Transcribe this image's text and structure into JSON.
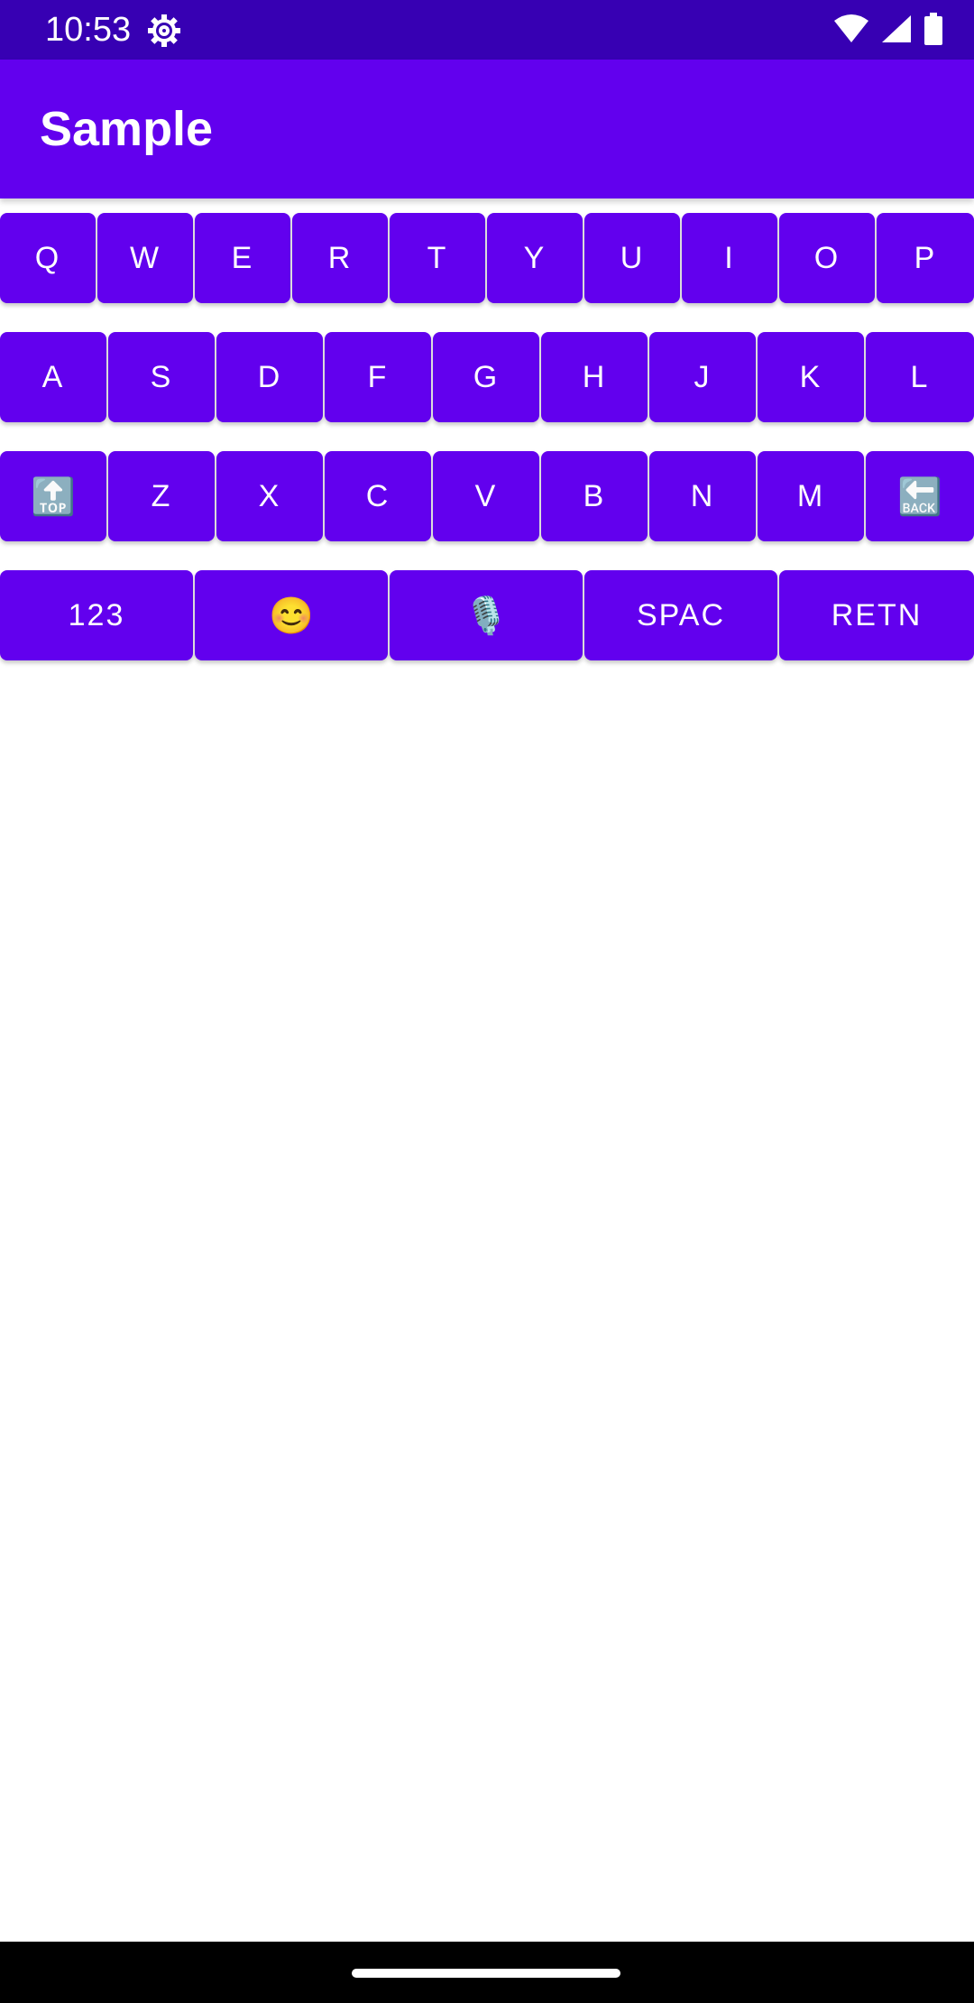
{
  "status_bar": {
    "time": "10:53",
    "icons": [
      "gear-icon",
      "wifi-icon",
      "signal-icon",
      "battery-icon"
    ],
    "background": "#3700b3"
  },
  "app_bar": {
    "title": "Sample",
    "background": "#6200ee"
  },
  "keyboard": {
    "key_color": "#6200ee",
    "row1": [
      "Q",
      "W",
      "E",
      "R",
      "T",
      "Y",
      "U",
      "I",
      "O",
      "P"
    ],
    "row2": [
      "A",
      "S",
      "D",
      "F",
      "G",
      "H",
      "J",
      "K",
      "L"
    ],
    "row3": [
      "🔝",
      "Z",
      "X",
      "C",
      "V",
      "B",
      "N",
      "M",
      "🔙"
    ],
    "row4": [
      "123",
      "😊",
      "🎙️",
      "SPAC",
      "RETN"
    ]
  },
  "nav_bar": {
    "background": "#000000"
  }
}
